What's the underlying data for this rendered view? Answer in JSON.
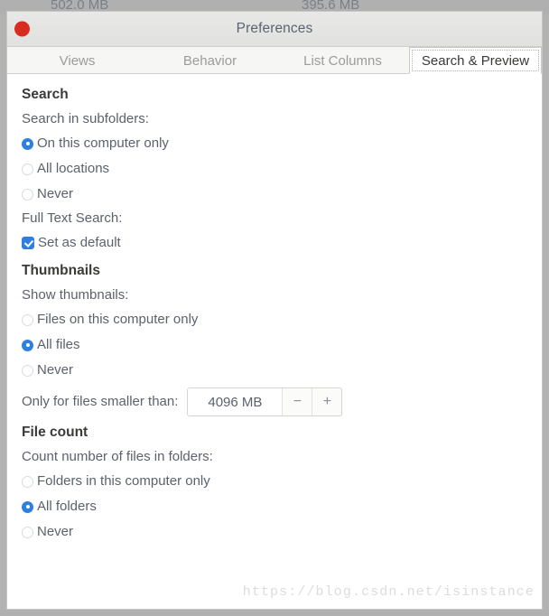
{
  "background": {
    "left_value": "502.0 MB",
    "right_value": "395.6 MB"
  },
  "window": {
    "title": "Preferences",
    "close_button_label": "",
    "close_color": "#d92c20"
  },
  "tabs": [
    {
      "label": "Views",
      "active": false
    },
    {
      "label": "Behavior",
      "active": false
    },
    {
      "label": "List Columns",
      "active": false
    },
    {
      "label": "Search & Preview",
      "active": true
    }
  ],
  "sections": {
    "search": {
      "title": "Search",
      "subfolders_label": "Search in subfolders:",
      "subfolders_options": [
        {
          "label": "On this computer only",
          "checked": true
        },
        {
          "label": "All locations",
          "checked": false
        },
        {
          "label": "Never",
          "checked": false
        }
      ],
      "fulltext_label": "Full Text Search:",
      "fulltext_checkbox": {
        "label": "Set as default",
        "checked": true
      }
    },
    "thumbnails": {
      "title": "Thumbnails",
      "show_label": "Show thumbnails:",
      "show_options": [
        {
          "label": "Files on this computer only",
          "checked": false
        },
        {
          "label": "All files",
          "checked": true
        },
        {
          "label": "Never",
          "checked": false
        }
      ],
      "size_label": "Only for files smaller than:",
      "size_value": "4096 MB",
      "decrement_label": "−",
      "increment_label": "+"
    },
    "file_count": {
      "title": "File count",
      "count_label": "Count number of files in folders:",
      "count_options": [
        {
          "label": "Folders in this computer only",
          "checked": false
        },
        {
          "label": "All folders",
          "checked": true
        },
        {
          "label": "Never",
          "checked": false
        }
      ]
    }
  },
  "watermark": "https://blog.csdn.net/isinstance",
  "colors": {
    "accent": "#2f7fe0",
    "heading": "#3a3a38",
    "label": "#5c616c",
    "tab_inactive": "#9b9b98"
  }
}
